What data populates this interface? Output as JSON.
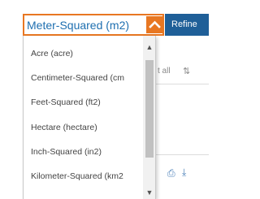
{
  "select": {
    "value": "Meter-Squared (m2)",
    "accent_color": "#e87722",
    "text_color": "#1e6fb0",
    "toggle_icon": "chevron-up-icon"
  },
  "refine_button": {
    "label": "Refine",
    "color": "#1f5f98"
  },
  "dropdown": {
    "options": [
      "Acre (acre)",
      "Centimeter-Squared (cm",
      "Feet-Squared (ft2)",
      "Hectare (hectare)",
      "Inch-Squared (in2)",
      "Kilometer-Squared (km2"
    ],
    "scroll_up_icon": "scroll-up-arrow-icon",
    "scroll_down_icon": "scroll-down-arrow-icon"
  },
  "background": {
    "select_all_fragment": "t all ",
    "toolbar_icons": [
      "print-icon",
      "download-icon"
    ]
  }
}
